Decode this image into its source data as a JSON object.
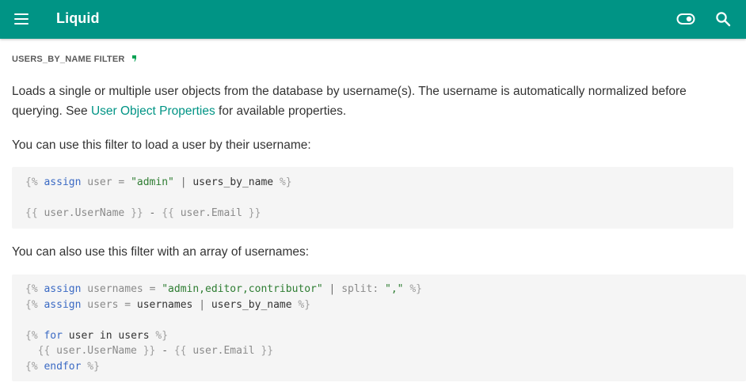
{
  "header": {
    "title": "Liquid",
    "menu_icon": "menu-icon",
    "theme_toggle_icon": "toggle-icon",
    "search_icon": "search-icon",
    "bar_color": "#009485"
  },
  "section": {
    "heading": "USERS_BY_NAME FILTER",
    "intro_before_link": "Loads a single or multiple user objects from the database by username(s). The username is automatically normalized before querying. See ",
    "intro_link": "User Object Properties",
    "intro_after_link": " for available properties.",
    "p_single": "You can use this filter to load a user by their username:",
    "p_array": "You can also use this filter with an array of usernames:"
  },
  "code1": {
    "line1": {
      "open": "{%",
      "kw": "assign",
      "var": "user",
      "eq": "=",
      "str": "\"admin\"",
      "pipe": "|",
      "fn": "users_by_name",
      "close": "%}"
    },
    "line2": {
      "open": "{{",
      "expr1": "user.UserName",
      "close1": "}}",
      "dash": "-",
      "open2": "{{",
      "expr2": "user.Email",
      "close2": "}}"
    }
  },
  "code2": {
    "line1": {
      "open": "{%",
      "kw": "assign",
      "var": "usernames",
      "eq": "=",
      "str": "\"admin,editor,contributor\"",
      "pipe": "|",
      "fn": "split:",
      "arg": "\",\"",
      "close": "%}"
    },
    "line2": {
      "open": "{%",
      "kw": "assign",
      "var": "users",
      "eq": "=",
      "src": "usernames",
      "pipe": "|",
      "fn": "users_by_name",
      "close": "%}"
    },
    "line3": {
      "open": "{%",
      "kw": "for",
      "rest": "user in users",
      "close": "%}"
    },
    "line4": {
      "open": "{{",
      "expr1": "user.UserName",
      "close1": "}}",
      "dash": "-",
      "open2": "{{",
      "expr2": "user.Email",
      "close2": "}}"
    },
    "line5": {
      "open": "{%",
      "kw": "endfor",
      "close": "%}"
    }
  }
}
